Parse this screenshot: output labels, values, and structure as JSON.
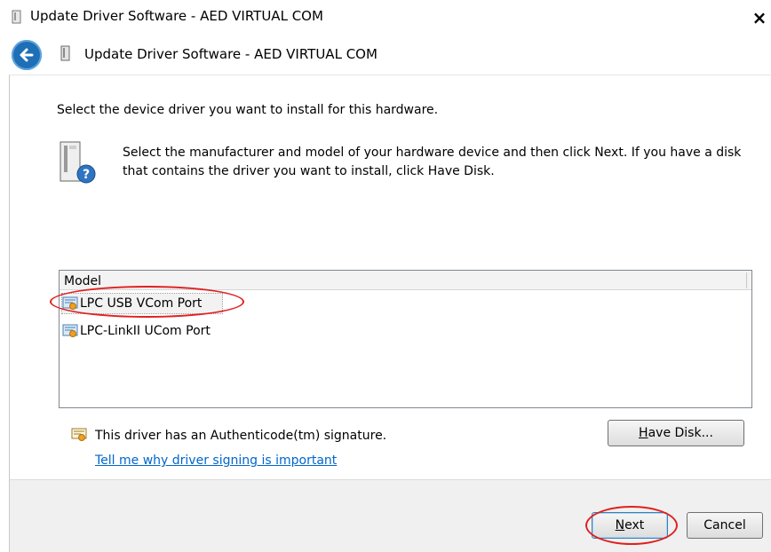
{
  "window": {
    "title": "Update Driver Software - AED VIRTUAL COM",
    "close_glyph": "×"
  },
  "header": {
    "title": "Update Driver Software - AED VIRTUAL COM",
    "back_icon": "back-arrow-icon"
  },
  "main": {
    "instruction": "Select the device driver you want to install for this hardware.",
    "description": "Select the manufacturer and model of your hardware device and then click Next. If you have a disk that contains the driver you want to install, click Have Disk.",
    "model_list": {
      "header": "Model",
      "items": [
        {
          "label": "LPC USB VCom Port",
          "selected": true
        },
        {
          "label": "LPC-LinkII UCom Port",
          "selected": false
        }
      ]
    },
    "signature_text": "This driver has an Authenticode(tm) signature.",
    "signing_link": "Tell me why driver signing is important",
    "have_disk": {
      "mnemonic": "H",
      "rest": "ave Disk..."
    }
  },
  "footer": {
    "next": {
      "mnemonic": "N",
      "rest": "ext"
    },
    "cancel": "Cancel"
  },
  "colors": {
    "link": "#0066cc",
    "annotation": "#e02020",
    "back_button": "#1e6fb6"
  }
}
